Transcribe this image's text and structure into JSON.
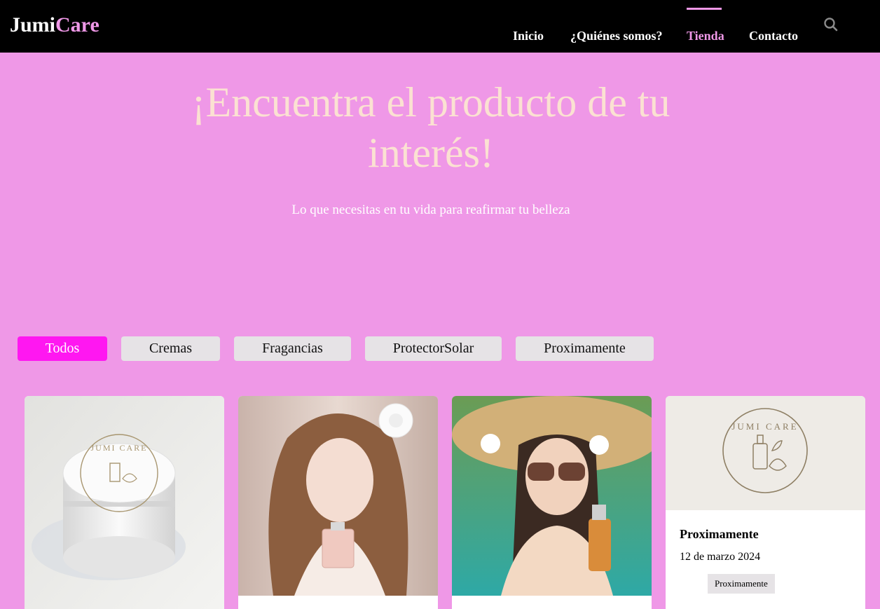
{
  "brand": {
    "part1": "Jumi",
    "part2": "Care"
  },
  "nav": {
    "items": [
      {
        "label": "Inicio"
      },
      {
        "label": "¿Quiénes somos?"
      },
      {
        "label": "Tienda"
      },
      {
        "label": "Contacto"
      }
    ],
    "active": "Tienda"
  },
  "hero": {
    "title": "¡Encuentra el producto de tu interés!",
    "subtitle": "Lo que necesitas en tu vida para reafirmar tu belleza"
  },
  "filters": {
    "items": [
      {
        "label": "Todos"
      },
      {
        "label": "Cremas"
      },
      {
        "label": "Fragancias"
      },
      {
        "label": "ProtectorSolar"
      },
      {
        "label": "Proximamente"
      }
    ],
    "active": "Todos"
  },
  "products": [
    {
      "image": "cream-jar"
    },
    {
      "image": "fragrance-model"
    },
    {
      "image": "sunscreen-model"
    },
    {
      "image": "jumi-care-logo",
      "logo_text": "JUMI CARE",
      "title": "Proximamente",
      "date": "12 de marzo 2024",
      "badge": "Proximamente"
    }
  ],
  "colors": {
    "background": "#ef98e7",
    "nav_bg": "#000000",
    "accent": "#ff17f1",
    "hero_title": "#fbe1d2",
    "filter_bg": "#e6e3e6"
  }
}
